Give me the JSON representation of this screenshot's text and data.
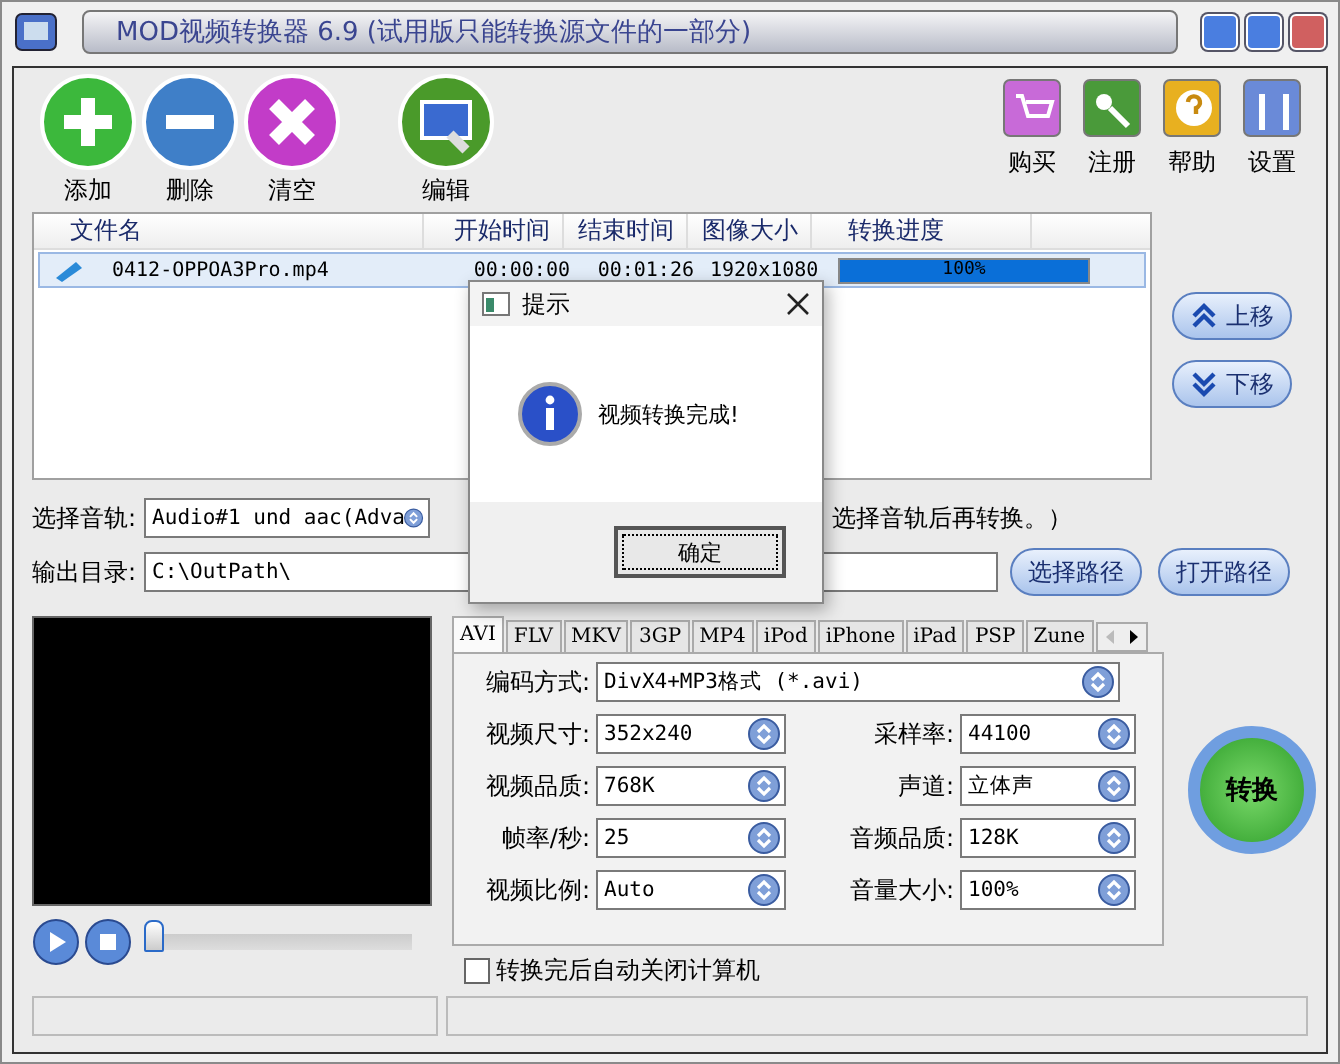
{
  "window": {
    "title": "MOD视频转换器 6.9 (试用版只能转换源文件的一部分)"
  },
  "toolbar": [
    {
      "label": "添加",
      "kind": "add"
    },
    {
      "label": "删除",
      "kind": "remove"
    },
    {
      "label": "清空",
      "kind": "clear"
    },
    {
      "label": "编辑",
      "kind": "edit"
    }
  ],
  "top_right": [
    {
      "label": "购买",
      "kind": "cart"
    },
    {
      "label": "注册",
      "kind": "key"
    },
    {
      "label": "帮助",
      "kind": "help"
    },
    {
      "label": "设置",
      "kind": "tools"
    }
  ],
  "file_table": {
    "columns": [
      "文件名",
      "开始时间",
      "结束时间",
      "图像大小",
      "转换进度"
    ],
    "rows": [
      {
        "name": "0412-OPPOA3Pro.mp4",
        "start": "00:00:00",
        "end": "00:01:26",
        "size": "1920x1080",
        "progress": "100%",
        "level": 1,
        "selected": true
      }
    ]
  },
  "move_buttons": [
    "上移",
    "下移"
  ],
  "audio": {
    "label": "选择音轨:",
    "value": "Audio#1 und aac(Adva",
    "hint": "选择音轨后再转换。）"
  },
  "output": {
    "label": "输出目录:",
    "value": "C:\\OutPath\\",
    "buttons": [
      "选择路径",
      "打开路径"
    ]
  },
  "player": {
    "level": 0
  },
  "format_tabs": [
    {
      "label": "AVI",
      "selected": true
    },
    {
      "label": "FLV",
      "selected": false
    },
    {
      "label": "MKV",
      "selected": false
    },
    {
      "label": "3GP",
      "selected": false
    },
    {
      "label": "MP4",
      "selected": false
    },
    {
      "label": "iPod",
      "selected": false
    },
    {
      "label": "iPhone",
      "selected": false
    },
    {
      "label": "iPad",
      "selected": false
    },
    {
      "label": "PSP",
      "selected": false
    },
    {
      "label": "Zune",
      "selected": false
    }
  ],
  "settings": [
    [
      {
        "label": "编码方式:",
        "value": "DivX4+MP3格式 (*.avi)"
      }
    ],
    [
      {
        "label": "视频尺寸:",
        "value": "352x240"
      },
      {
        "label": "采样率:",
        "value": "44100"
      }
    ],
    [
      {
        "label": "视频品质:",
        "value": "768K"
      },
      {
        "label": "声道:",
        "value": "立体声"
      }
    ],
    [
      {
        "label": "帧率/秒:",
        "value": "25"
      },
      {
        "label": "音频品质:",
        "value": "128K"
      }
    ],
    [
      {
        "label": "视频比例:",
        "value": "Auto"
      },
      {
        "label": "音量大小:",
        "value": "100%"
      }
    ]
  ],
  "convert_button": "转换",
  "shutdown": {
    "label": "转换完后自动关闭计算机",
    "checked": false
  },
  "dialog": {
    "title": "提示",
    "message": "视频转换完成!",
    "ok": "确定"
  }
}
